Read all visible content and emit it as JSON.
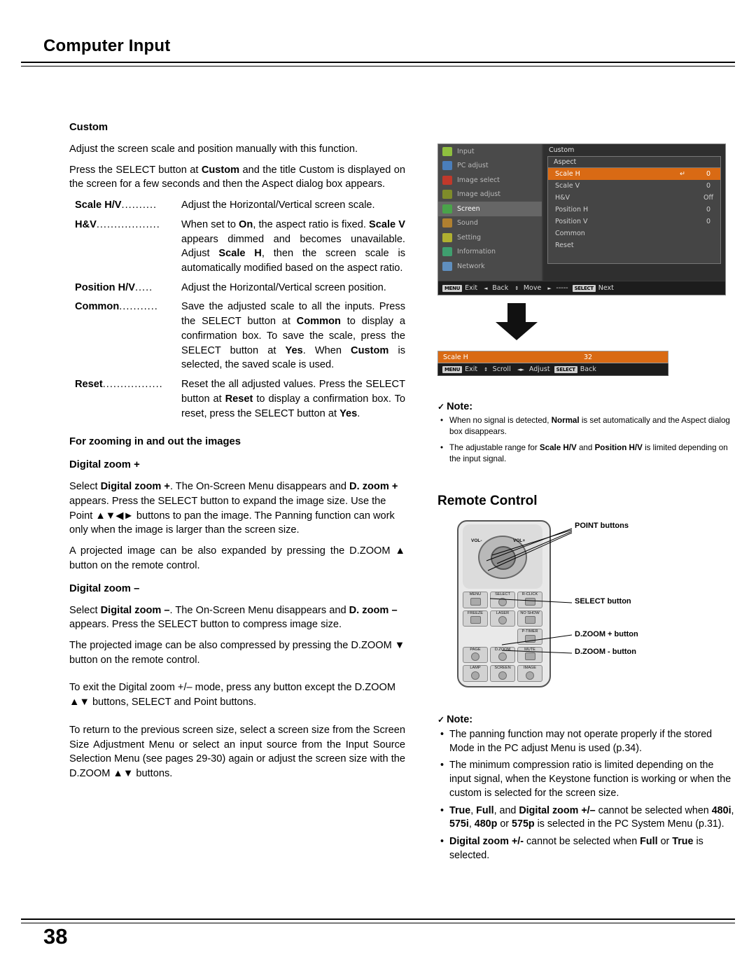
{
  "header": {
    "title": "Computer Input"
  },
  "footer": {
    "page_number": "38"
  },
  "left": {
    "custom_heading": "Custom",
    "p1": "Adjust the screen scale and position manually with this function.",
    "p2_a": "Press the SELECT button at ",
    "p2_b": "Custom",
    "p2_c": " and the title Custom is displayed on the screen for a few seconds and then the Aspect dialog box appears.",
    "defs": [
      {
        "term": "Scale H/V",
        "dots": "..........",
        "desc": "Adjust the Horizontal/Vertical screen scale."
      },
      {
        "term": "H&V",
        "dots": "..................",
        "desc": "When set to On, the aspect ratio is fixed. Scale V appears dimmed and becomes unavailable. Adjust Scale H, then the screen scale is automatically modified based on the aspect ratio."
      },
      {
        "term": "Position H/V",
        "dots": ".....",
        "desc": "Adjust the Horizontal/Vertical screen position."
      },
      {
        "term": "Common",
        "dots": "...........",
        "desc": "Save the adjusted scale to all the inputs. Press the SELECT button at Common to display a confirmation box. To save the scale, press the SELECT button at Yes. When Custom is selected, the saved scale is used."
      },
      {
        "term": "Reset",
        "dots": ".................",
        "desc": "Reset the all adjusted values. Press the SELECT button at Reset to display a confirmation box. To reset, press the SELECT button at Yes."
      }
    ],
    "zoom_heading": "For zooming in and out the images",
    "dzoom_plus_heading": "Digital zoom +",
    "dzoom_plus_p1": "Select Digital zoom +. The On-Screen Menu disappears and D. zoom + appears. Press the SELECT button to expand the image size. Use the Point ▲▼◄► buttons to pan the image. The Panning function can work only when the image is larger than the screen size.",
    "dzoom_plus_p2": "A projected image can be also expanded by pressing the D.ZOOM ▲ button on the remote control.",
    "dzoom_minus_heading": "Digital zoom –",
    "dzoom_minus_p1": "Select Digital zoom –. The On-Screen Menu disappears and D. zoom – appears. Press the SELECT button to compress image size.",
    "dzoom_minus_p2": "The projected image can be also compressed by pressing the D.ZOOM ▼ button on the remote control.",
    "exit_p": "To exit the Digital zoom +/– mode, press any button except the D.ZOOM ▲▼ buttons, SELECT and Point buttons.",
    "return_p": "To return to the previous screen size, select a screen size from the Screen Size Adjustment Menu or select an input source from the Input Source Selection Menu (see pages 29-30) again or adjust the screen size with the D.ZOOM ▲▼ buttons."
  },
  "osd": {
    "menu_items": [
      {
        "label": "Input",
        "color": "#8fbf3f",
        "active": false
      },
      {
        "label": "PC adjust",
        "color": "#4a7ebb",
        "active": false
      },
      {
        "label": "Image select",
        "color": "#c0392b",
        "active": false
      },
      {
        "label": "Image adjust",
        "color": "#7f8c2a",
        "active": false
      },
      {
        "label": "Screen",
        "color": "#4aa34a",
        "active": true
      },
      {
        "label": "Sound",
        "color": "#b08030",
        "active": false
      },
      {
        "label": "Setting",
        "color": "#b0b030",
        "active": false
      },
      {
        "label": "Information",
        "color": "#3f9f6f",
        "active": false
      },
      {
        "label": "Network",
        "color": "#5f8fbf",
        "active": false
      }
    ],
    "panel_title": "Custom",
    "dialog_title": "Aspect",
    "rows": [
      {
        "label": "Scale H",
        "mid": "↵",
        "val": "0",
        "selected": true
      },
      {
        "label": "Scale V",
        "mid": "",
        "val": "0",
        "selected": false
      },
      {
        "label": "H&V",
        "mid": "",
        "val": "Off",
        "selected": false
      },
      {
        "label": "Position H",
        "mid": "",
        "val": "0",
        "selected": false
      },
      {
        "label": "Position V",
        "mid": "",
        "val": "0",
        "selected": false
      },
      {
        "label": "Common",
        "mid": "",
        "val": "",
        "selected": false
      },
      {
        "label": "Reset",
        "mid": "",
        "val": "",
        "selected": false
      }
    ],
    "bottom_bar": [
      {
        "key": "MENU",
        "label": "Exit"
      },
      {
        "key": "◄",
        "label": "Back"
      },
      {
        "key": "↕",
        "label": "Move"
      },
      {
        "key": "►",
        "label": "-----"
      },
      {
        "key": "SELECT",
        "label": "Next"
      }
    ]
  },
  "scalebar": {
    "label": "Scale H",
    "value": "32",
    "bottom": [
      {
        "key": "MENU",
        "label": "Exit"
      },
      {
        "key": "↕",
        "label": "Scroll"
      },
      {
        "key": "◄►",
        "label": "Adjust"
      },
      {
        "key": "SELECT",
        "label": "Back"
      }
    ]
  },
  "note1": {
    "title": "Note:",
    "items": [
      "When no signal is detected, Normal is set automatically and the Aspect dialog box disappears.",
      "The adjustable range for Scale H/V and Position H/V is limited depending on the input signal."
    ]
  },
  "remote_control": {
    "title": "Remote Control",
    "labels": {
      "point": "POINT buttons",
      "select": "SELECT button",
      "dzoom_plus": "D.ZOOM + button",
      "dzoom_minus": "D.ZOOM - button"
    },
    "keys": [
      "MENU",
      "SELECT",
      "R-CLICK",
      "FREEZE",
      "LASER",
      "NO SHOW",
      "",
      "",
      "P-TIMER",
      "PAGE",
      "D.ZOOM",
      "MUTE",
      "LAMP",
      "SCREEN",
      "IMAGE"
    ],
    "vol_left": "VOL-",
    "vol_right": "VOL+"
  },
  "note2": {
    "title": "Note:",
    "items": [
      "The panning function may not operate properly if the stored Mode in the PC adjust Menu is used (p.34).",
      "The minimum compression ratio is limited depending on the input signal, when the Keystone function is working or when the custom is selected for the screen size.",
      "True, Full, and Digital zoom +/– cannot be selected when 480i, 575i, 480p or 575p is selected in the PC System Menu (p.31).",
      "Digital zoom +/- cannot be selected when Full or True is selected."
    ]
  }
}
